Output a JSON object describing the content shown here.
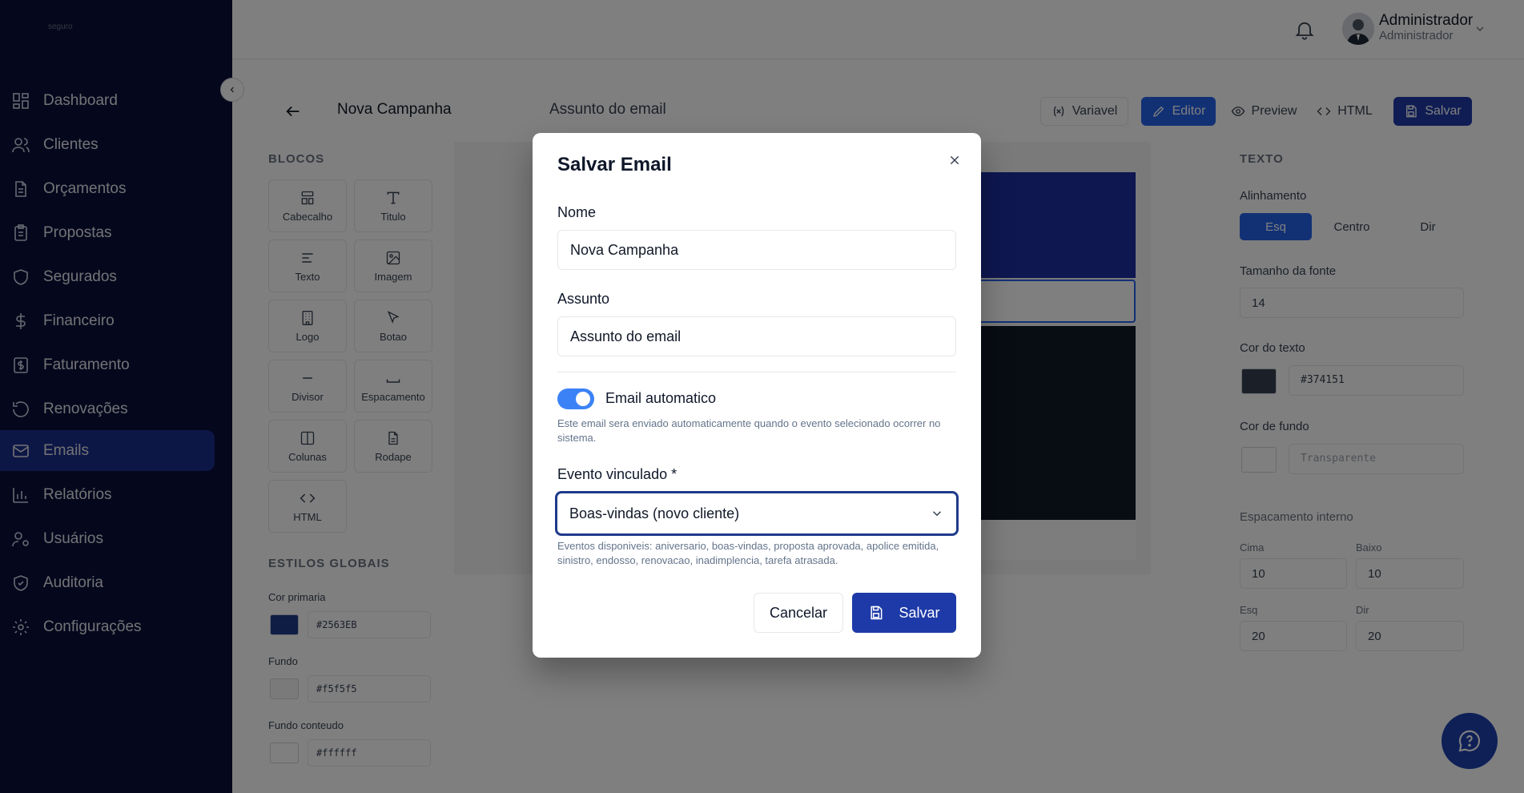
{
  "app": {
    "logo_text": "seguro"
  },
  "sidebar": {
    "items": [
      {
        "label": "Dashboard",
        "icon": "dashboard-icon"
      },
      {
        "label": "Clientes",
        "icon": "users-icon"
      },
      {
        "label": "Orçamentos",
        "icon": "file-icon"
      },
      {
        "label": "Propostas",
        "icon": "clipboard-icon"
      },
      {
        "label": "Segurados",
        "icon": "shield-icon"
      },
      {
        "label": "Financeiro",
        "icon": "dollar-icon"
      },
      {
        "label": "Faturamento",
        "icon": "receipt-icon"
      },
      {
        "label": "Renovações",
        "icon": "refresh-icon"
      },
      {
        "label": "Emails",
        "icon": "mail-icon",
        "active": true
      },
      {
        "label": "Relatórios",
        "icon": "bar-chart-icon"
      },
      {
        "label": "Usuários",
        "icon": "user-settings-icon"
      },
      {
        "label": "Auditoria",
        "icon": "shield-check-icon"
      },
      {
        "label": "Configurações",
        "icon": "gear-icon"
      }
    ]
  },
  "topbar": {
    "user_name": "Administrador",
    "user_role": "Administrador"
  },
  "editor": {
    "campaign_name": "Nova Campanha",
    "subject": "Assunto do email",
    "toolbar": {
      "variable": "Variavel",
      "editor": "Editor",
      "preview": "Preview",
      "html": "HTML",
      "save": "Salvar"
    }
  },
  "blocks_panel": {
    "title": "BLOCOS",
    "blocks": [
      {
        "label": "Cabecalho",
        "icon": "layout-header-icon"
      },
      {
        "label": "Titulo",
        "icon": "text-type-icon"
      },
      {
        "label": "Texto",
        "icon": "align-left-icon"
      },
      {
        "label": "Imagem",
        "icon": "image-icon"
      },
      {
        "label": "Logo",
        "icon": "building-icon"
      },
      {
        "label": "Botao",
        "icon": "cursor-icon"
      },
      {
        "label": "Divisor",
        "icon": "minus-icon"
      },
      {
        "label": "Espacamento",
        "icon": "spacing-icon"
      },
      {
        "label": "Colunas",
        "icon": "columns-icon"
      },
      {
        "label": "Rodape",
        "icon": "file-text-icon"
      },
      {
        "label": "HTML",
        "icon": "code-icon"
      }
    ]
  },
  "global_styles": {
    "title": "ESTILOS GLOBAIS",
    "primary_label": "Cor primaria",
    "primary_value": "#2563EB",
    "primary_color": "#1e3a8a",
    "bg_label": "Fundo",
    "bg_value": "#f5f5f5",
    "content_bg_label": "Fundo conteudo",
    "content_bg_value": "#ffffff"
  },
  "props_panel": {
    "title": "TEXTO",
    "align_label": "Alinhamento",
    "align_options": [
      "Esq",
      "Centro",
      "Dir"
    ],
    "font_size_label": "Tamanho da fonte",
    "font_size_value": "14",
    "text_color_label": "Cor do texto",
    "text_color_value": "#374151",
    "bg_color_label": "Cor de fundo",
    "bg_color_placeholder": "Transparente",
    "padding_label": "Espacamento interno",
    "padding_top_label": "Cima",
    "padding_top_value": "10",
    "padding_bottom_label": "Baixo",
    "padding_bottom_value": "10",
    "padding_left_label": "Esq",
    "padding_left_value": "20",
    "padding_right_label": "Dir",
    "padding_right_value": "20"
  },
  "modal": {
    "title": "Salvar Email",
    "name_label": "Nome",
    "name_value": "Nova Campanha",
    "subject_label": "Assunto",
    "subject_value": "Assunto do email",
    "auto_toggle_label": "Email automatico",
    "auto_toggle_on": true,
    "auto_help": "Este email sera enviado automaticamente quando o evento selecionado ocorrer no sistema.",
    "event_label": "Evento vinculado *",
    "event_value": "Boas-vindas (novo cliente)",
    "event_help": "Eventos disponiveis: aniversario, boas-vindas, proposta aprovada, apolice emitida, sinistro, endosso, renovacao, inadimplencia, tarefa atrasada.",
    "cancel": "Cancelar",
    "save": "Salvar"
  },
  "colors": {
    "sidebar_bg": "#0a0f3a",
    "active_nav": "#1b2f8c",
    "primary_button": "#1e3aa8",
    "toggle_on": "#3b82f6"
  }
}
